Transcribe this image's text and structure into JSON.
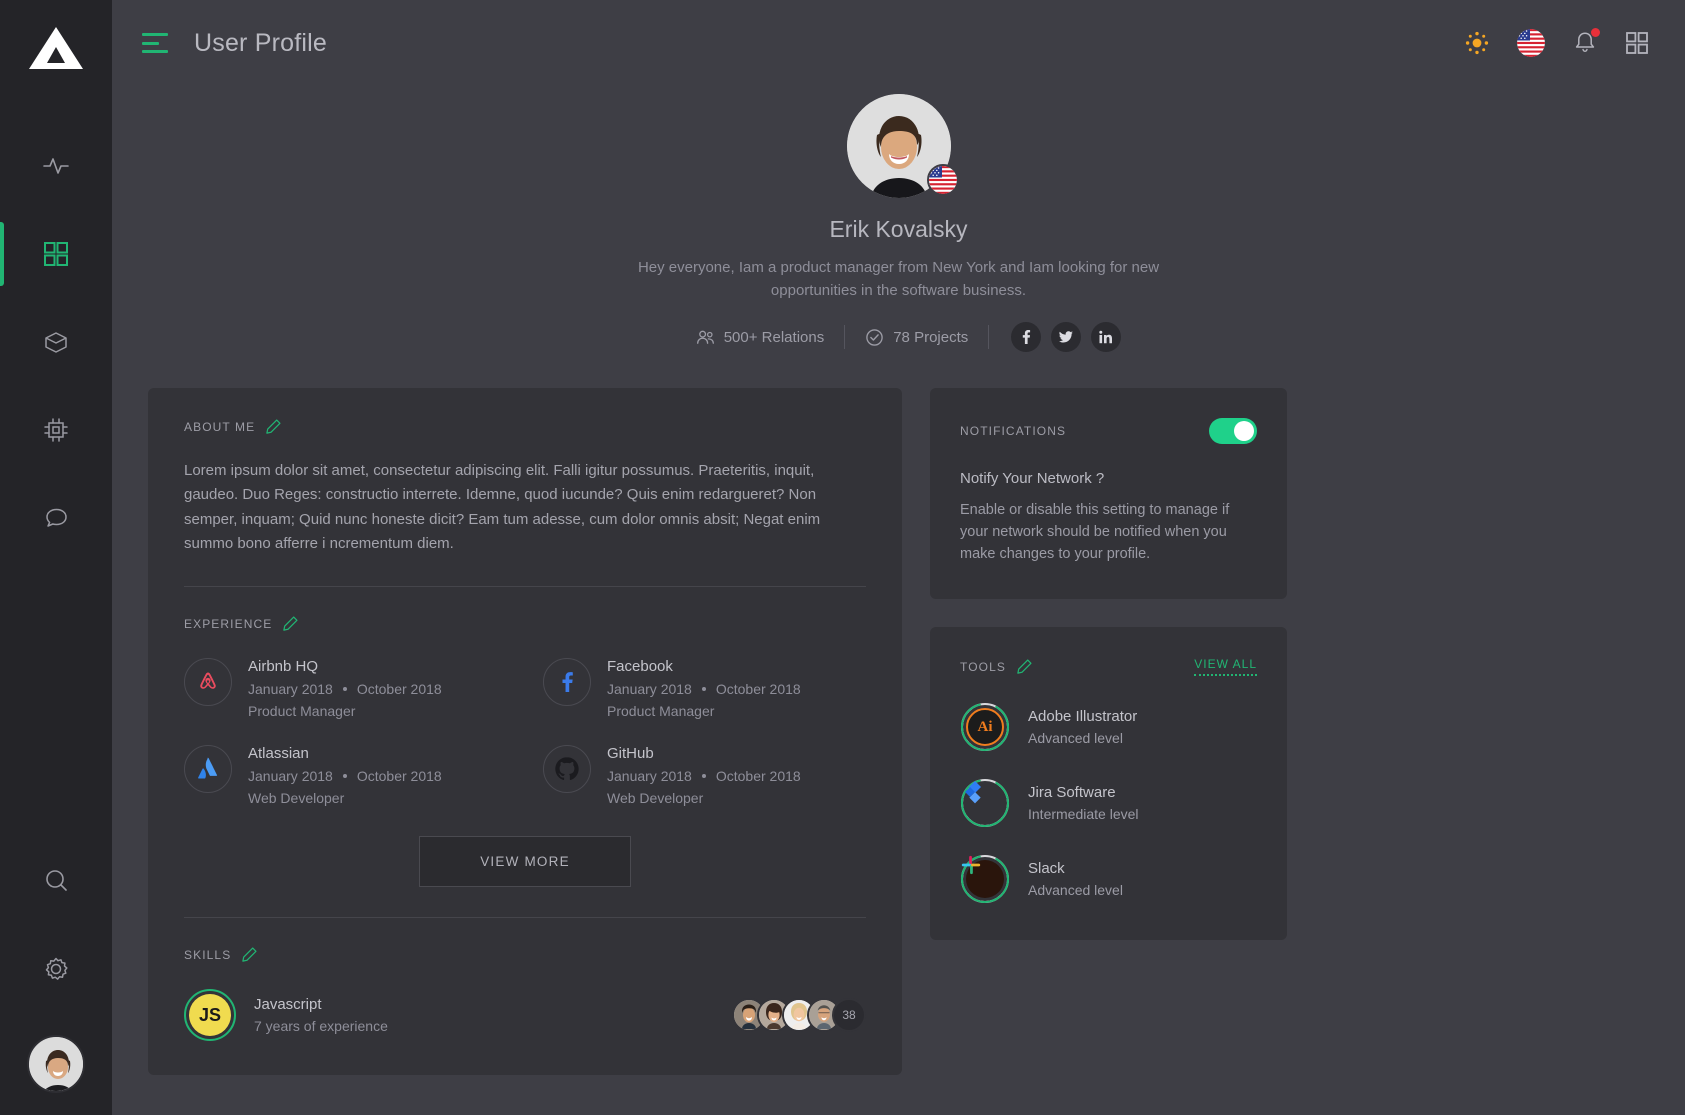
{
  "brand": {
    "logo_name": "triangle-logo"
  },
  "colors": {
    "accent_green": "#21b573",
    "toggle_green": "#1fd18a",
    "page_bg": "#3e3e45",
    "card_bg": "#333338",
    "rail_bg": "#242428",
    "badge_red": "#e8303a",
    "sun_orange": "#f5a623"
  },
  "rail": {
    "items": [
      {
        "name": "activity",
        "icon": "activity-pulse-icon",
        "active": false
      },
      {
        "name": "dashboard",
        "icon": "grid-squares-icon",
        "active": true
      },
      {
        "name": "packages",
        "icon": "box-cube-icon",
        "active": false
      },
      {
        "name": "devices",
        "icon": "chip-processor-icon",
        "active": false
      },
      {
        "name": "messages",
        "icon": "chat-bubble-icon",
        "active": false
      }
    ],
    "bottom": [
      {
        "name": "search",
        "icon": "search-icon"
      },
      {
        "name": "settings",
        "icon": "gear-icon"
      }
    ],
    "avatar_label": "Erik Kovalsky"
  },
  "topbar": {
    "menu_icon": "hamburger-icon",
    "title": "User Profile",
    "actions": [
      {
        "name": "theme",
        "icon": "sun-icon"
      },
      {
        "name": "language",
        "icon": "us-flag-icon"
      },
      {
        "name": "notifications",
        "icon": "bell-icon",
        "has_badge": true
      },
      {
        "name": "apps",
        "icon": "grid-apps-icon"
      }
    ]
  },
  "profile": {
    "name": "Erik Kovalsky",
    "bio": "Hey everyone,  Iam a product manager from New York and Iam looking for new opportunities in the software business.",
    "country_flag": "us-flag-icon",
    "stats": [
      {
        "icon": "users-icon",
        "label": "500+ Relations"
      },
      {
        "icon": "check-circle-icon",
        "label": "78 Projects"
      }
    ],
    "socials": [
      {
        "name": "facebook",
        "icon": "facebook-icon"
      },
      {
        "name": "twitter",
        "icon": "twitter-icon"
      },
      {
        "name": "linkedin",
        "icon": "linkedin-icon"
      }
    ]
  },
  "about": {
    "title": "ABOUT ME",
    "edit_icon": "pencil-icon",
    "text": "Lorem ipsum dolor sit amet, consectetur adipiscing elit. Falli igitur possumus. Praeteritis, inquit, gaudeo. Duo Reges: constructio interrete. Idemne, quod iucunde? Quis enim redargueret? Non semper, inquam; Quid nunc honeste dicit? Eam tum adesse, cum dolor omnis absit; Negat enim summo bono afferre i ncrementum diem."
  },
  "experience": {
    "title": "EXPERIENCE",
    "edit_icon": "pencil-icon",
    "items": [
      {
        "company": "Airbnb HQ",
        "logo": "airbnb-icon",
        "start": "January 2018",
        "end": "October 2018",
        "role": "Product Manager"
      },
      {
        "company": "Facebook",
        "logo": "facebook-icon",
        "start": "January 2018",
        "end": "October 2018",
        "role": "Product Manager"
      },
      {
        "company": "Atlassian",
        "logo": "atlassian-icon",
        "start": "January 2018",
        "end": "October 2018",
        "role": "Web Developer"
      },
      {
        "company": "GitHub",
        "logo": "github-icon",
        "start": "January 2018",
        "end": "October 2018",
        "role": "Web Developer"
      }
    ],
    "view_more_label": "VIEW MORE"
  },
  "skills": {
    "title": "SKILLS",
    "edit_icon": "pencil-icon",
    "items": [
      {
        "name": "Javascript",
        "logo_text": "JS",
        "experience": "7 years of experience",
        "people_count": "38"
      }
    ]
  },
  "notifications": {
    "title": "NOTIFICATIONS",
    "toggle_on": true,
    "question": "Notify Your Network ?",
    "description": "Enable or disable this setting to manage if your network should be notified when you make changes to your profile."
  },
  "tools": {
    "title": "TOOLS",
    "edit_icon": "pencil-icon",
    "view_all_label": "VIEW ALL",
    "items": [
      {
        "name": "Adobe Illustrator",
        "level": "Advanced level",
        "icon": "adobe-illustrator-icon",
        "progress": 88
      },
      {
        "name": "Jira Software",
        "level": "Intermediate level",
        "icon": "jira-icon",
        "progress": 88
      },
      {
        "name": "Slack",
        "level": "Advanced level",
        "icon": "slack-icon",
        "progress": 88
      }
    ]
  }
}
